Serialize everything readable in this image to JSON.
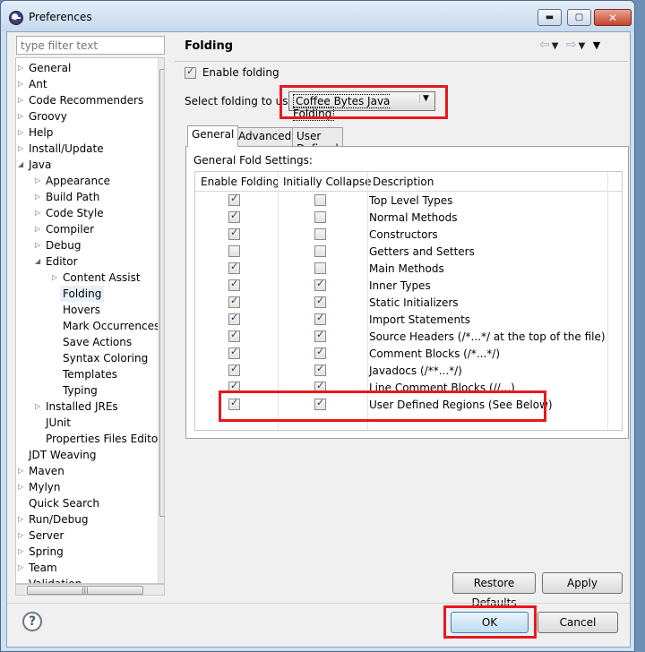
{
  "window": {
    "title": "Preferences",
    "controls": {
      "minimize": "▬",
      "maximize": "▢",
      "close": "✕"
    }
  },
  "sidebar": {
    "filter_placeholder": "type filter text",
    "items": [
      {
        "label": "General",
        "level": 0,
        "arrow": "right"
      },
      {
        "label": "Ant",
        "level": 0,
        "arrow": "right"
      },
      {
        "label": "Code Recommenders",
        "level": 0,
        "arrow": "right"
      },
      {
        "label": "Groovy",
        "level": 0,
        "arrow": "right"
      },
      {
        "label": "Help",
        "level": 0,
        "arrow": "right"
      },
      {
        "label": "Install/Update",
        "level": 0,
        "arrow": "right"
      },
      {
        "label": "Java",
        "level": 0,
        "arrow": "down"
      },
      {
        "label": "Appearance",
        "level": 1,
        "arrow": "right"
      },
      {
        "label": "Build Path",
        "level": 1,
        "arrow": "right"
      },
      {
        "label": "Code Style",
        "level": 1,
        "arrow": "right"
      },
      {
        "label": "Compiler",
        "level": 1,
        "arrow": "right"
      },
      {
        "label": "Debug",
        "level": 1,
        "arrow": "right"
      },
      {
        "label": "Editor",
        "level": 1,
        "arrow": "down"
      },
      {
        "label": "Content Assist",
        "level": 2,
        "arrow": "right"
      },
      {
        "label": "Folding",
        "level": 2,
        "arrow": "",
        "selected": true
      },
      {
        "label": "Hovers",
        "level": 2,
        "arrow": ""
      },
      {
        "label": "Mark Occurrences",
        "level": 2,
        "arrow": ""
      },
      {
        "label": "Save Actions",
        "level": 2,
        "arrow": ""
      },
      {
        "label": "Syntax Coloring",
        "level": 2,
        "arrow": ""
      },
      {
        "label": "Templates",
        "level": 2,
        "arrow": ""
      },
      {
        "label": "Typing",
        "level": 2,
        "arrow": ""
      },
      {
        "label": "Installed JREs",
        "level": 1,
        "arrow": "right"
      },
      {
        "label": "JUnit",
        "level": 1,
        "arrow": ""
      },
      {
        "label": "Properties Files Editor",
        "level": 1,
        "arrow": ""
      },
      {
        "label": "JDT Weaving",
        "level": 0,
        "arrow": ""
      },
      {
        "label": "Maven",
        "level": 0,
        "arrow": "right"
      },
      {
        "label": "Mylyn",
        "level": 0,
        "arrow": "right"
      },
      {
        "label": "Quick Search",
        "level": 0,
        "arrow": ""
      },
      {
        "label": "Run/Debug",
        "level": 0,
        "arrow": "right"
      },
      {
        "label": "Server",
        "level": 0,
        "arrow": "right"
      },
      {
        "label": "Spring",
        "level": 0,
        "arrow": "right"
      },
      {
        "label": "Team",
        "level": 0,
        "arrow": "right"
      },
      {
        "label": "Validation",
        "level": 0,
        "arrow": ""
      }
    ]
  },
  "page": {
    "title": "Folding",
    "enable_folding_label": "Enable folding",
    "enable_folding_checked": true,
    "select_label": "Select folding to use:",
    "select_value": "Coffee Bytes Java Folding",
    "tabs": [
      "General",
      "Advanced",
      "User Defined Regions"
    ],
    "active_tab": "General",
    "group_label": "General Fold Settings:",
    "columns": [
      "Enable Folding",
      "Initially Collapse",
      "Description"
    ],
    "rows": [
      {
        "enable": true,
        "collapse": false,
        "desc": "Top Level Types"
      },
      {
        "enable": true,
        "collapse": false,
        "desc": "Normal Methods"
      },
      {
        "enable": true,
        "collapse": false,
        "desc": "Constructors"
      },
      {
        "enable": false,
        "collapse": false,
        "desc": "Getters and Setters"
      },
      {
        "enable": true,
        "collapse": false,
        "desc": "Main Methods"
      },
      {
        "enable": true,
        "collapse": true,
        "desc": "Inner Types"
      },
      {
        "enable": true,
        "collapse": true,
        "desc": "Static Initializers"
      },
      {
        "enable": true,
        "collapse": true,
        "desc": "Import Statements"
      },
      {
        "enable": true,
        "collapse": true,
        "desc": "Source Headers (/*...*/ at the top of the file)"
      },
      {
        "enable": true,
        "collapse": true,
        "desc": "Comment Blocks (/*...*/)"
      },
      {
        "enable": true,
        "collapse": true,
        "desc": "Javadocs (/**...*/)"
      },
      {
        "enable": true,
        "collapse": true,
        "desc": "Line Comment Blocks (//...)"
      },
      {
        "enable": true,
        "collapse": true,
        "desc": "User Defined Regions (See Below)"
      }
    ]
  },
  "buttons": {
    "restore_defaults": "Restore Defaults",
    "apply": "Apply",
    "ok": "OK",
    "cancel": "Cancel",
    "help": "?"
  },
  "nav_icons": {
    "back": "⇦",
    "forward": "⇨",
    "menu": "▼"
  },
  "colors": {
    "highlight_border": "#e8181f",
    "selection": "#e8f0fb"
  }
}
